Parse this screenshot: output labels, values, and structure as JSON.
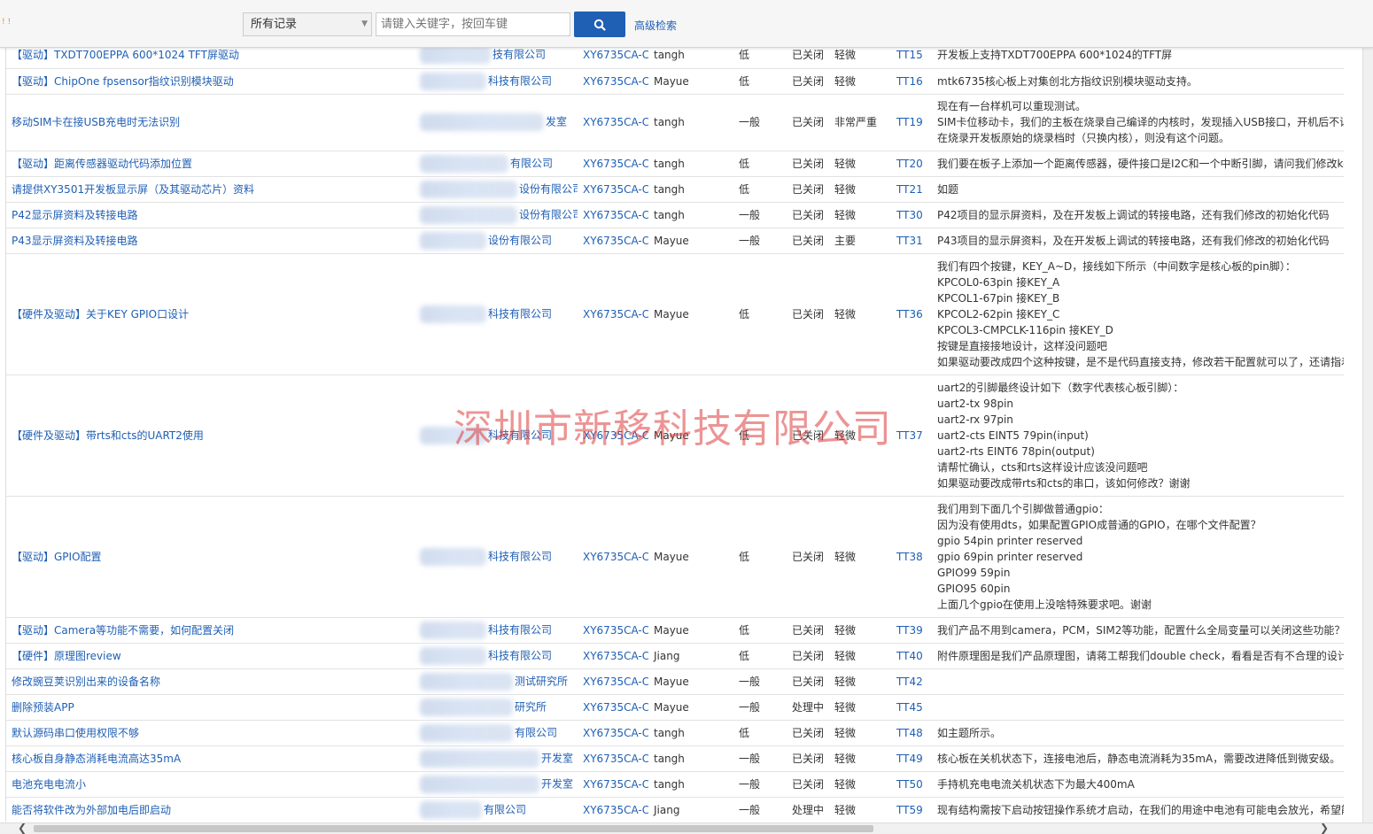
{
  "toolbar": {
    "logo_text": "! !",
    "scope_value": "所有记录",
    "search_placeholder": "请键入关键字，按回车键",
    "advanced_search_label": "高级检索"
  },
  "watermark": "深圳市新移科技有限公司",
  "rows": [
    {
      "title": "【驱动】TXDT700EPPA 600*1024 TFT屏驱动",
      "company": "技有限公司",
      "product": "XY6735CA-C",
      "owner": "tangh",
      "priority": "低",
      "status": "已关闭",
      "severity": "轻微",
      "id": "TT15",
      "desc": [
        "开发板上支持TXDT700EPPA 600*1024的TFT屏"
      ]
    },
    {
      "title": "【驱动】ChipOne fpsensor指纹识别模块驱动",
      "company": "科技有限公司",
      "product": "XY6735CA-C",
      "owner": "Mayue",
      "priority": "低",
      "status": "已关闭",
      "severity": "轻微",
      "id": "TT16",
      "desc": [
        "mtk6735核心板上对集创北方指纹识别模块驱动支持。"
      ]
    },
    {
      "title": "移动SIM卡在接USB充电时无法识别",
      "company": "发室",
      "product": "XY6735CA-C",
      "owner": "tangh",
      "priority": "一般",
      "status": "已关闭",
      "severity": "非常严重",
      "id": "TT19",
      "desc": [
        "现在有一台样机可以重现测试。",
        "SIM卡位移动卡，我们的主板在烧录自己编译的内核时，发现插入USB接口，开机后不识",
        "在烧录开发板原始的烧录档时（只换内核），则没有这个问题。"
      ]
    },
    {
      "title": "【驱动】距离传感器驱动代码添加位置",
      "company": "有限公司",
      "product": "XY6735CA-C",
      "owner": "tangh",
      "priority": "低",
      "status": "已关闭",
      "severity": "轻微",
      "id": "TT20",
      "desc": [
        "我们要在板子上添加一个距离传感器，硬件接口是I2C和一个中断引脚，请问我们修改ke"
      ]
    },
    {
      "title": "请提供XY3501开发板显示屏（及其驱动芯片）资料",
      "company": "设份有限公司",
      "product": "XY6735CA-C",
      "owner": "tangh",
      "priority": "低",
      "status": "已关闭",
      "severity": "轻微",
      "id": "TT21",
      "desc": [
        "如题"
      ]
    },
    {
      "title": "P42显示屏资料及转接电路",
      "company": "设份有限公司",
      "product": "XY6735CA-C",
      "owner": "tangh",
      "priority": "一般",
      "status": "已关闭",
      "severity": "轻微",
      "id": "TT30",
      "desc": [
        "P42项目的显示屏资料，及在开发板上调试的转接电路，还有我们修改的初始化代码"
      ]
    },
    {
      "title": "P43显示屏资料及转接电路",
      "company": "设份有限公司",
      "product": "XY6735CA-C",
      "owner": "Mayue",
      "priority": "一般",
      "status": "已关闭",
      "severity": "主要",
      "id": "TT31",
      "desc": [
        "P43项目的显示屏资料，及在开发板上调试的转接电路，还有我们修改的初始化代码"
      ]
    },
    {
      "title": "【硬件及驱动】关于KEY GPIO口设计",
      "company": "科技有限公司",
      "product": "XY6735CA-C",
      "owner": "Mayue",
      "priority": "低",
      "status": "已关闭",
      "severity": "轻微",
      "id": "TT36",
      "desc": [
        "我们有四个按键，KEY_A~D，接线如下所示（中间数字是核心板的pin脚）：",
        "KPCOL0-63pin 接KEY_A",
        "KPCOL1-67pin 接KEY_B",
        "KPCOL2-62pin 接KEY_C",
        "KPCOL3-CMPCLK-116pin 接KEY_D",
        "按键是直接接地设计，这样没问题吧",
        "如果驱动要改成四个这种按键，是不是代码直接支持，修改若干配置就可以了，还请指着"
      ]
    },
    {
      "title": "【硬件及驱动】带rts和cts的UART2使用",
      "company": "科技有限公司",
      "product": "XY6735CA-C",
      "owner": "Mayue",
      "priority": "低",
      "status": "已关闭",
      "severity": "轻微",
      "id": "TT37",
      "desc": [
        "uart2的引脚最终设计如下（数字代表核心板引脚）：",
        "uart2-tx 98pin",
        "uart2-rx 97pin",
        "uart2-cts EINT5 79pin(input)",
        "uart2-rts EINT6 78pin(output)",
        "请帮忙确认，cts和rts这样设计应该没问题吧",
        "如果驱动要改成带rts和cts的串口，该如何修改？谢谢"
      ]
    },
    {
      "title": "【驱动】GPIO配置",
      "company": "科技有限公司",
      "product": "XY6735CA-C",
      "owner": "Mayue",
      "priority": "低",
      "status": "已关闭",
      "severity": "轻微",
      "id": "TT38",
      "desc": [
        "我们用到下面几个引脚做普通gpio：",
        "因为没有使用dts，如果配置GPIO成普通的GPIO，在哪个文件配置？",
        "gpio 54pin printer reserved",
        "gpio 69pin printer reserved",
        "GPIO99 59pin",
        "GPIO95 60pin",
        "上面几个gpio在使用上没啥特殊要求吧。谢谢"
      ]
    },
    {
      "title": "【驱动】Camera等功能不需要，如何配置关闭",
      "company": "科技有限公司",
      "product": "XY6735CA-C",
      "owner": "Mayue",
      "priority": "低",
      "status": "已关闭",
      "severity": "轻微",
      "id": "TT39",
      "desc": [
        "我们产品不用到camera，PCM，SIM2等功能，配置什么全局变量可以关闭这些功能？谢"
      ]
    },
    {
      "title": "【硬件】原理图review",
      "company": "科技有限公司",
      "product": "XY6735CA-C",
      "owner": "Jiang",
      "priority": "低",
      "status": "已关闭",
      "severity": "轻微",
      "id": "TT40",
      "desc": [
        "附件原理图是我们产品原理图，请蒋工帮我们double check，看看是否有不合理的设计"
      ]
    },
    {
      "title": "修改豌豆荚识别出来的设备名称",
      "company": "测试研究所",
      "product": "XY6735CA-C",
      "owner": "Mayue",
      "priority": "一般",
      "status": "已关闭",
      "severity": "轻微",
      "id": "TT42",
      "desc": []
    },
    {
      "title": "删除预装APP",
      "company": "研究所",
      "product": "XY6735CA-C",
      "owner": "Mayue",
      "priority": "一般",
      "status": "处理中",
      "severity": "轻微",
      "id": "TT45",
      "desc": []
    },
    {
      "title": "默认源码串口使用权限不够",
      "company": "有限公司",
      "product": "XY6735CA-C",
      "owner": "tangh",
      "priority": "低",
      "status": "已关闭",
      "severity": "轻微",
      "id": "TT48",
      "desc": [
        "如主题所示。"
      ]
    },
    {
      "title": "核心板自身静态消耗电流高达35mA",
      "company": "开发室",
      "product": "XY6735CA-C",
      "owner": "tangh",
      "priority": "一般",
      "status": "已关闭",
      "severity": "轻微",
      "id": "TT49",
      "desc": [
        "核心板在关机状态下，连接电池后，静态电流消耗为35mA，需要改进降低到微安级。"
      ]
    },
    {
      "title": "电池充电电流小",
      "company": "开发室",
      "product": "XY6735CA-C",
      "owner": "tangh",
      "priority": "一般",
      "status": "已关闭",
      "severity": "轻微",
      "id": "TT50",
      "desc": [
        "手持机充电电流关机状态下为最大400mA"
      ]
    },
    {
      "title": "能否将软件改为外部加电后即启动",
      "company": "有限公司",
      "product": "XY6735CA-C",
      "owner": "Jiang",
      "priority": "一般",
      "status": "处理中",
      "severity": "轻微",
      "id": "TT59",
      "desc": [
        "现有结构需按下启动按钮操作系统才启动，在我们的用途中电池有可能电会放光，希望能"
      ]
    }
  ]
}
